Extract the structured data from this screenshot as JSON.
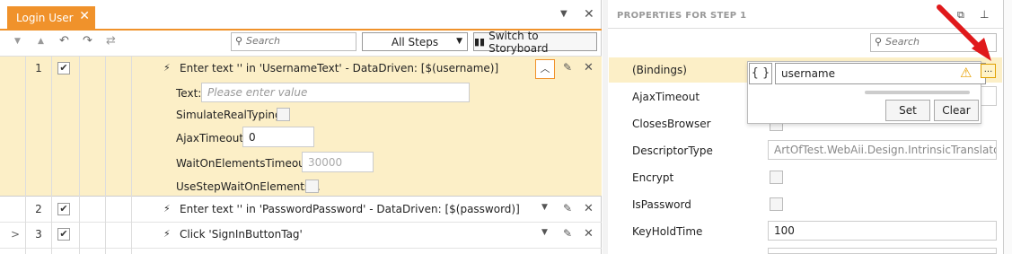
{
  "left_panel": {
    "tab_title": "Login User",
    "search_placeholder": "Search",
    "steps_filter": "All Steps",
    "storyboard_label": "Switch to Storyboard"
  },
  "steps": [
    {
      "num": "1",
      "text": "Enter text '' in 'UsernameText' - DataDriven: [$(username)]"
    },
    {
      "num": "2",
      "text": "Enter text '' in 'PasswordPassword' - DataDriven: [$(password)]"
    },
    {
      "num": "3",
      "text": "Click 'SignInButtonTag'"
    }
  ],
  "step1_props": {
    "text_label": "Text:",
    "text_placeholder": "Please enter value",
    "simulate_label": "SimulateRealTyping:",
    "ajax_label": "AjaxTimeout:",
    "ajax_value": "0",
    "wait_label": "WaitOnElementsTimeout:",
    "wait_value": "30000",
    "usestep_label": "UseStepWaitOnElements..."
  },
  "right_panel": {
    "title": "PROPERTIES FOR STEP 1",
    "search_placeholder": "Search",
    "props": [
      {
        "label": "(Bindings)",
        "value": ""
      },
      {
        "label": "AjaxTimeout",
        "value": ""
      },
      {
        "label": "ClosesBrowser",
        "value": ""
      },
      {
        "label": "DescriptorType",
        "value": "ArtOfTest.WebAii.Design.IntrinsicTranslators.D"
      },
      {
        "label": "Encrypt",
        "value": ""
      },
      {
        "label": "IsPassword",
        "value": ""
      },
      {
        "label": "KeyHoldTime",
        "value": "100"
      }
    ],
    "binding_popup": {
      "braces": "{ }",
      "value": "username",
      "ellipsis": "...",
      "set_label": "Set",
      "clear_label": "Clear"
    }
  },
  "colors": {
    "accent": "#f0922b",
    "highlight": "#fcefc7",
    "arrow": "#e0191b"
  }
}
